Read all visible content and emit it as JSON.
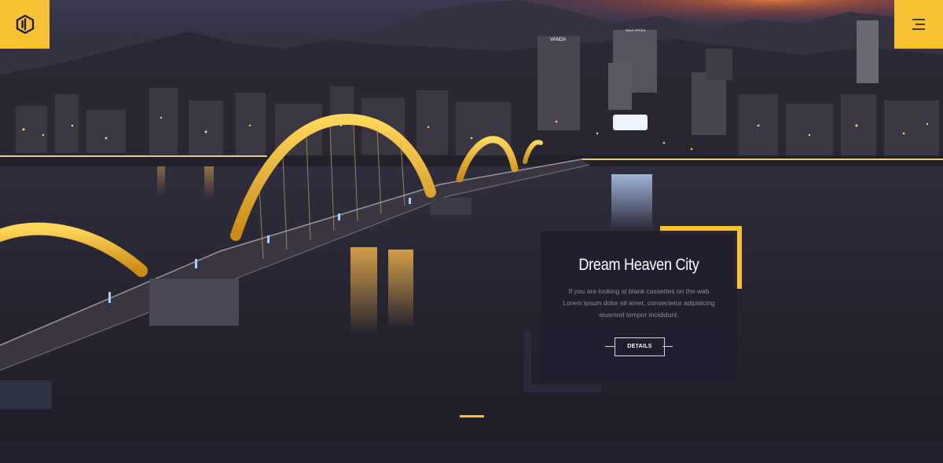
{
  "header": {
    "logo_icon": "bracket-logo-icon",
    "menu_icon": "hamburger-menu-icon"
  },
  "hero": {
    "image_alt": "",
    "signs": {
      "vanda": "VANDA",
      "opera": "SALE OPERA"
    }
  },
  "card": {
    "title": "Dream Heaven City",
    "description": "If you are looking at blank cassettes on the web Lorem ipsum dolor sit amet, consectetur adipisicing eiusmod tempor incididunt.",
    "button_label": "DETAILS"
  },
  "slider": {
    "active_index": 1
  },
  "colors": {
    "accent": "#f6c132",
    "card_bg": "#211f2e",
    "page_bg": "#1f1d2b"
  }
}
